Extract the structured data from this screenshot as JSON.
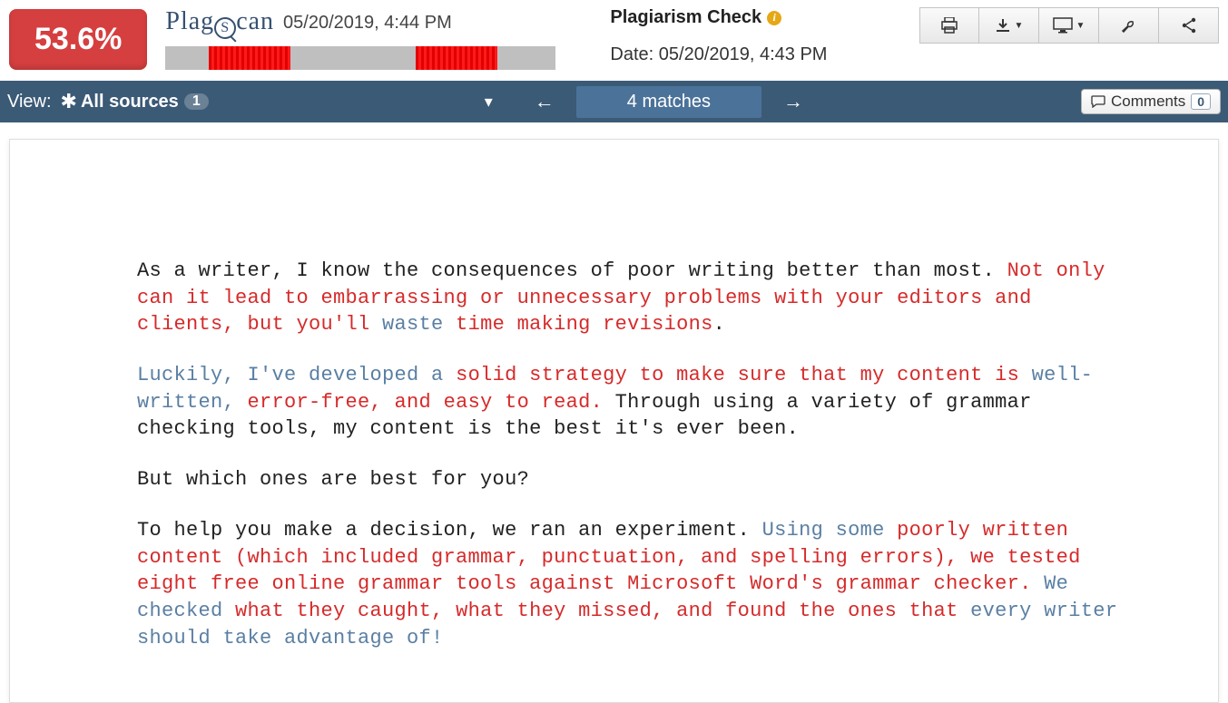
{
  "header": {
    "percentage": "53.6%",
    "brand_prefix": "Plag",
    "brand_s": "S",
    "brand_suffix": "can",
    "upload_timestamp": "05/20/2019, 4:44 PM",
    "check_title": "Plagiarism Check",
    "check_date": "Date: 05/20/2019, 4:43 PM",
    "progress_segments": [
      {
        "left_pct": 11,
        "width_pct": 21
      },
      {
        "left_pct": 64,
        "width_pct": 21
      }
    ]
  },
  "toolbar": {
    "print": "print",
    "download": "download",
    "screen": "screen",
    "settings": "settings",
    "share": "share"
  },
  "navbar": {
    "view_label": "View:",
    "all_sources": "All sources",
    "source_count": "1",
    "matches_label": "4 matches",
    "comments_label": "Comments",
    "comments_count": "0"
  },
  "document": {
    "p1": {
      "t1": "As a writer, I know the consequences of poor writing better than most. ",
      "r1": "Not only can it lead to embarrassing or unnecessary problems with your editors and clients, but you'll ",
      "b1": "waste ",
      "r2": "time making revisions",
      "t2": "."
    },
    "p2": {
      "b1": "Luckily, I've developed a ",
      "r1": "solid strategy to make sure that my content is ",
      "b2": "well-written, ",
      "r2": "error-free, and easy to read. ",
      "t1": "Through using a variety of grammar checking tools, my content is the best it's ever been."
    },
    "p3": {
      "t1": "But which ones are best for you?"
    },
    "p4": {
      "t1": "To help you make a decision, we ran an experiment. ",
      "b1": "Using some ",
      "r1": "poorly written content (which included grammar, punctuation, and spelling errors), we tested eight free online grammar tools against Microsoft Word's grammar checker. ",
      "b2": "We checked ",
      "r2": "what they caught, what they missed, and found the ones that ",
      "b3": "every writer should take advantage of!"
    }
  }
}
